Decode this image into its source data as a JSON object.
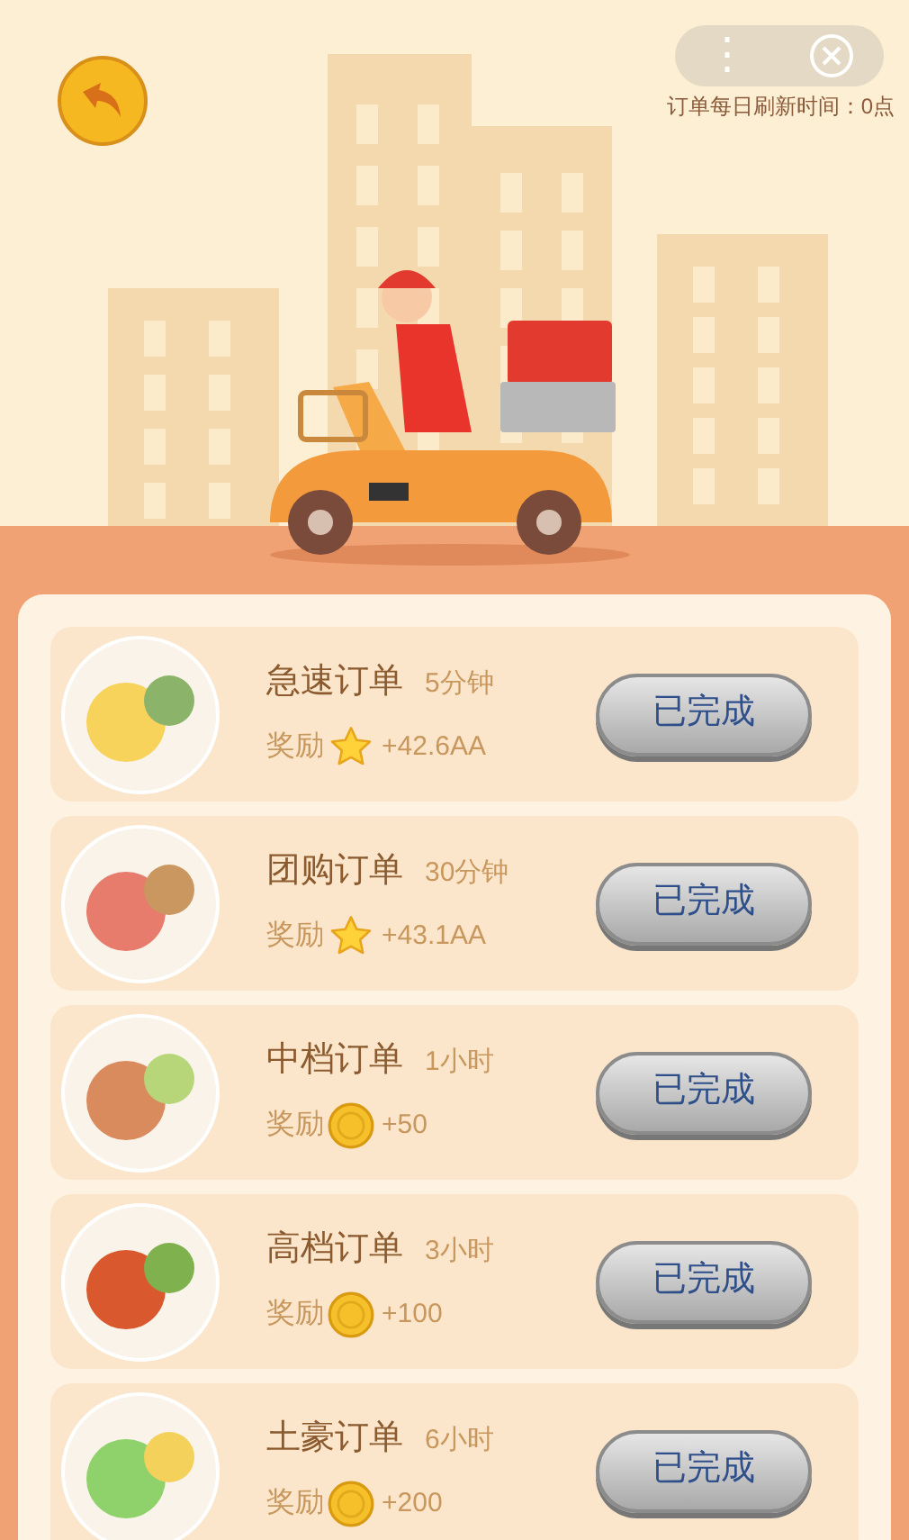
{
  "header": {
    "refresh_note": "订单每日刷新时间：0点",
    "menu_glyph": "⋮"
  },
  "orders": [
    {
      "title": "急速订单",
      "duration": "5分钟",
      "reward_label": "奖励",
      "kind": "star",
      "reward": "+42.6AA",
      "button": "已完成",
      "done": true
    },
    {
      "title": "团购订单",
      "duration": "30分钟",
      "reward_label": "奖励",
      "kind": "star",
      "reward": "+43.1AA",
      "button": "已完成",
      "done": true
    },
    {
      "title": "中档订单",
      "duration": "1小时",
      "reward_label": "奖励",
      "kind": "coin",
      "reward": "+50",
      "button": "已完成",
      "done": true
    },
    {
      "title": "高档订单",
      "duration": "3小时",
      "reward_label": "奖励",
      "kind": "coin",
      "reward": "+100",
      "button": "已完成",
      "done": true
    },
    {
      "title": "土豪订单",
      "duration": "6小时",
      "reward_label": "奖励",
      "kind": "coin",
      "reward": "+200",
      "button": "已完成",
      "done": true
    }
  ]
}
